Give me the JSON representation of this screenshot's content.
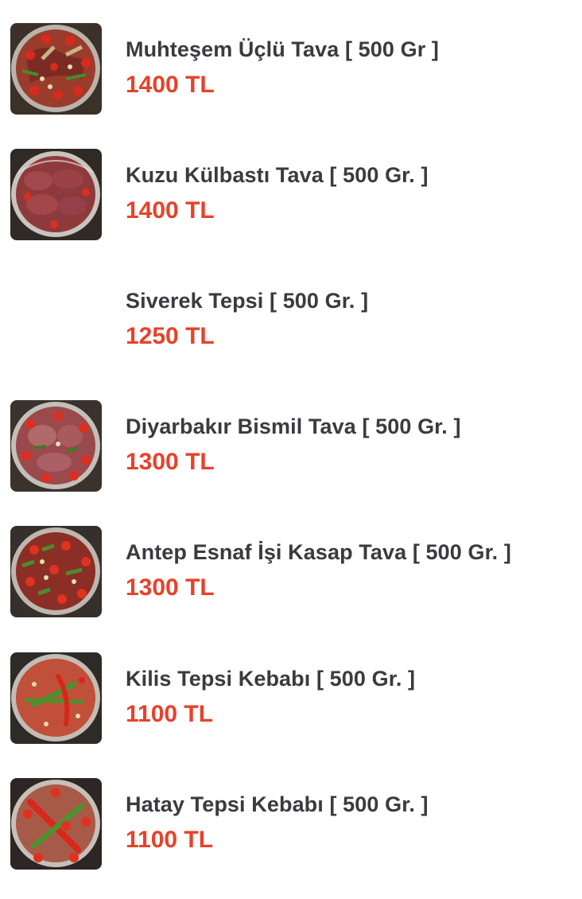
{
  "menu": {
    "items": [
      {
        "name": "Muhteşem Üçlü Tava [ 500 Gr ]",
        "price": "1400 TL",
        "image": "tava-photo"
      },
      {
        "name": "Kuzu Külbastı Tava [ 500 Gr. ]",
        "price": "1400 TL",
        "image": "kulbasti-photo"
      },
      {
        "name": "Siverek Tepsi [ 500 Gr. ]",
        "price": "1250 TL",
        "image": ""
      },
      {
        "name": "Diyarbakır Bismil Tava [ 500 Gr. ]",
        "price": "1300 TL",
        "image": "bismil-photo"
      },
      {
        "name": "Antep Esnaf İşi Kasap Tava [ 500 Gr. ]",
        "price": "1300 TL",
        "image": "antep-photo"
      },
      {
        "name": "Kilis Tepsi Kebabı [ 500 Gr. ]",
        "price": "1100 TL",
        "image": "kilis-photo"
      },
      {
        "name": "Hatay Tepsi Kebabı [ 500 Gr. ]",
        "price": "1100 TL",
        "image": "hatay-photo"
      }
    ]
  },
  "colors": {
    "name_text": "#3a3a3f",
    "price_text": "#e8412a",
    "background": "#ffffff"
  }
}
